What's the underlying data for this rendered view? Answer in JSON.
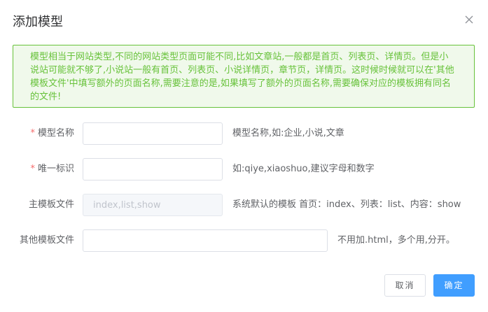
{
  "dialog": {
    "title": "添加模型",
    "close_icon": "close-icon"
  },
  "alert": {
    "text": "模型相当于网站类型,不同的网站类型页面可能不同,比如文章站,一般都是首页、列表页、详情页。但是小说站可能就不够了,小说站一般有首页、列表页、小说详情页，章节页，详情页。这时候时候就可以在'其他模板文件'中填写额外的页面名称,需要注意的是,如果填写了额外的页面名称,需要确保对应的模板拥有同名的文件!",
    "color": "#67c23a"
  },
  "form": {
    "name": {
      "required_mark": "*",
      "label": "模型名称",
      "value": "",
      "hint": "模型名称,如:企业,小说,文章"
    },
    "identifier": {
      "required_mark": "*",
      "label": "唯一标识",
      "value": "",
      "hint": "如:qiye,xiaoshuo,建议字母和数字"
    },
    "main_template": {
      "label": "主模板文件",
      "placeholder": "index,list,show",
      "hint": "系统默认的模板 首页：index、列表：list、内容：show"
    },
    "other_template": {
      "label": "其他模板文件",
      "value": "",
      "hint": "不用加.html，多个用,分开。"
    }
  },
  "buttons": {
    "cancel": "取消",
    "confirm": "确定",
    "primary_color": "#409eff"
  }
}
